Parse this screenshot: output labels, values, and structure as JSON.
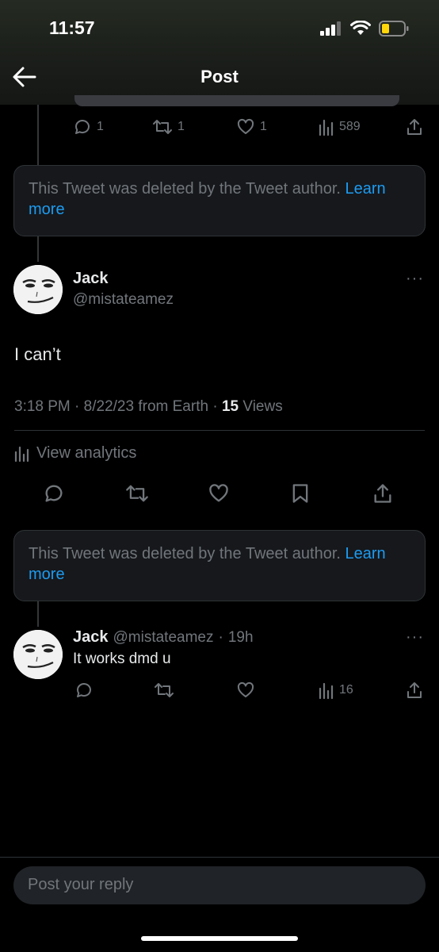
{
  "status_bar": {
    "time": "11:57"
  },
  "header": {
    "title": "Post",
    "back_icon": "arrow-left-icon"
  },
  "parent_actions": {
    "replies": "1",
    "retweets": "1",
    "likes": "1",
    "views": "589"
  },
  "deleted_notice": {
    "text": "This Tweet was deleted by the Tweet author.",
    "link": "Learn",
    "link2": "more"
  },
  "main_tweet": {
    "name": "Jack",
    "handle": "@mistateamez",
    "text": "I can’t",
    "time": "3:18 PM",
    "date": "8/22/23",
    "source": "from Earth",
    "views_count": "15",
    "views_label": "Views",
    "analytics_label": "View analytics"
  },
  "reply": {
    "name": "Jack",
    "handle": "@mistateamez",
    "age": "19h",
    "text": "It works dmd u",
    "views": "16"
  },
  "composer": {
    "placeholder": "Post your reply"
  },
  "colors": {
    "accent": "#1d9bf0",
    "muted": "#71767b",
    "card": "#16181c"
  }
}
